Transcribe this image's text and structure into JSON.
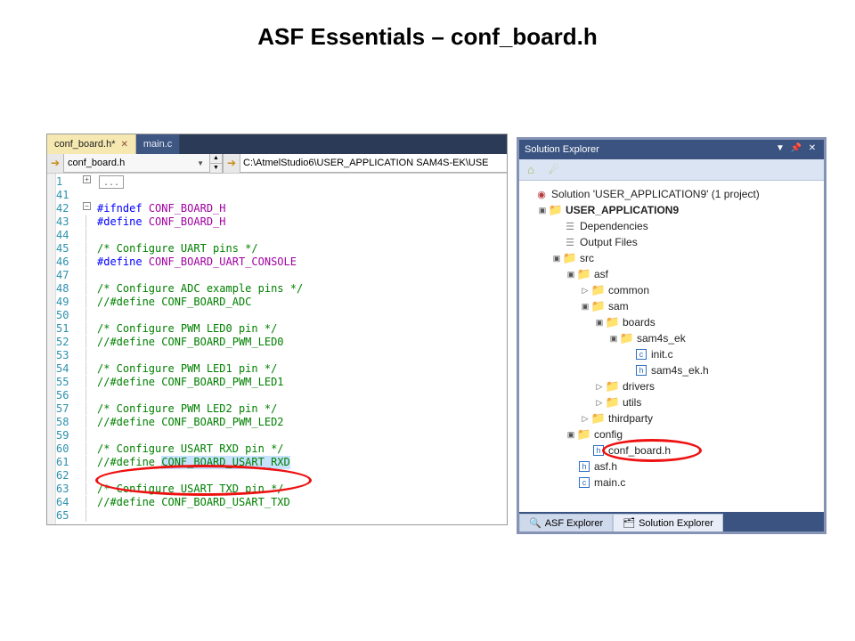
{
  "slide_title": "ASF Essentials – conf_board.h",
  "editor": {
    "tabs": [
      {
        "label": "conf_board.h*",
        "active": true
      },
      {
        "label": "main.c",
        "active": false
      }
    ],
    "nav_scope": "conf_board.h",
    "nav_path": "C:\\AtmelStudio6\\USER_APPLICATION SAM4S-EK\\USE",
    "lines": [
      {
        "n": 1,
        "fold": "plus",
        "segs": [
          {
            "cls": "dots",
            "t": "..."
          }
        ]
      },
      {
        "n": 41,
        "fold": "",
        "segs": []
      },
      {
        "n": 42,
        "fold": "minus",
        "segs": [
          {
            "cls": "c-dir",
            "t": "#ifndef"
          },
          {
            "cls": "c-txt",
            "t": " "
          },
          {
            "cls": "c-def",
            "t": "CONF_BOARD_H"
          }
        ]
      },
      {
        "n": 43,
        "fold": "bar",
        "segs": [
          {
            "cls": "c-dir",
            "t": "#define"
          },
          {
            "cls": "c-txt",
            "t": " "
          },
          {
            "cls": "c-def",
            "t": "CONF_BOARD_H"
          }
        ]
      },
      {
        "n": 44,
        "fold": "bar",
        "segs": []
      },
      {
        "n": 45,
        "fold": "bar",
        "segs": [
          {
            "cls": "c-cmt",
            "t": "/* Configure UART pins */"
          }
        ]
      },
      {
        "n": 46,
        "fold": "bar",
        "segs": [
          {
            "cls": "c-dir",
            "t": "#define"
          },
          {
            "cls": "c-txt",
            "t": " "
          },
          {
            "cls": "c-def",
            "t": "CONF_BOARD_UART_CONSOLE"
          }
        ]
      },
      {
        "n": 47,
        "fold": "bar",
        "segs": []
      },
      {
        "n": 48,
        "fold": "bar",
        "segs": [
          {
            "cls": "c-cmt",
            "t": "/* Configure ADC example pins */"
          }
        ]
      },
      {
        "n": 49,
        "fold": "bar",
        "segs": [
          {
            "cls": "c-cmt",
            "t": "//#define CONF_BOARD_ADC"
          }
        ]
      },
      {
        "n": 50,
        "fold": "bar",
        "segs": []
      },
      {
        "n": 51,
        "fold": "bar",
        "segs": [
          {
            "cls": "c-cmt",
            "t": "/* Configure PWM LED0 pin */"
          }
        ]
      },
      {
        "n": 52,
        "fold": "bar",
        "segs": [
          {
            "cls": "c-cmt",
            "t": "//#define CONF_BOARD_PWM_LED0"
          }
        ]
      },
      {
        "n": 53,
        "fold": "bar",
        "segs": []
      },
      {
        "n": 54,
        "fold": "bar",
        "segs": [
          {
            "cls": "c-cmt",
            "t": "/* Configure PWM LED1 pin */"
          }
        ]
      },
      {
        "n": 55,
        "fold": "bar",
        "segs": [
          {
            "cls": "c-cmt",
            "t": "//#define CONF_BOARD_PWM_LED1"
          }
        ]
      },
      {
        "n": 56,
        "fold": "bar",
        "segs": []
      },
      {
        "n": 57,
        "fold": "bar",
        "segs": [
          {
            "cls": "c-cmt",
            "t": "/* Configure PWM LED2 pin */"
          }
        ]
      },
      {
        "n": 58,
        "fold": "bar",
        "segs": [
          {
            "cls": "c-cmt",
            "t": "//#define CONF_BOARD_PWM_LED2"
          }
        ]
      },
      {
        "n": 59,
        "fold": "bar",
        "segs": []
      },
      {
        "n": 60,
        "fold": "bar",
        "segs": [
          {
            "cls": "c-cmt",
            "t": "/* Configure USART RXD pin */"
          }
        ]
      },
      {
        "n": 61,
        "fold": "bar",
        "segs": [
          {
            "cls": "c-cmt",
            "t": "//#define "
          },
          {
            "cls": "c-cmt c-sel",
            "t": "CONF_BOARD_USART_RXD"
          }
        ]
      },
      {
        "n": 62,
        "fold": "bar",
        "segs": []
      },
      {
        "n": 63,
        "fold": "bar",
        "segs": [
          {
            "cls": "c-cmt",
            "t": "/* Configure USART TXD pin */"
          }
        ]
      },
      {
        "n": 64,
        "fold": "bar",
        "segs": [
          {
            "cls": "c-cmt",
            "t": "//#define CONF_BOARD_USART_TXD"
          }
        ]
      },
      {
        "n": 65,
        "fold": "bar",
        "segs": []
      }
    ]
  },
  "solution": {
    "title": "Solution Explorer",
    "root": "Solution 'USER_APPLICATION9' (1 project)",
    "tree": [
      {
        "ind": 0,
        "exp": "",
        "icon": "sol",
        "glyph": "◉",
        "label_key": "solution.root"
      },
      {
        "ind": 1,
        "exp": "▢",
        "icon": "folder",
        "glyph": "📁",
        "bold": true,
        "t": "USER_APPLICATION9"
      },
      {
        "ind": 2,
        "exp": "",
        "icon": "ref",
        "glyph": "☰",
        "t": "Dependencies"
      },
      {
        "ind": 2,
        "exp": "",
        "icon": "ref",
        "glyph": "☰",
        "t": "Output Files"
      },
      {
        "ind": 2,
        "exp": "▢",
        "icon": "folder",
        "glyph": "📁",
        "t": "src"
      },
      {
        "ind": 3,
        "exp": "▢",
        "icon": "folder",
        "glyph": "📁",
        "t": "asf"
      },
      {
        "ind": 4,
        "exp": "▷",
        "icon": "folder",
        "glyph": "📁",
        "t": "common"
      },
      {
        "ind": 4,
        "exp": "▢",
        "icon": "folder",
        "glyph": "📁",
        "t": "sam"
      },
      {
        "ind": 5,
        "exp": "▢",
        "icon": "folder",
        "glyph": "📁",
        "t": "boards"
      },
      {
        "ind": 6,
        "exp": "▢",
        "icon": "folder",
        "glyph": "📁",
        "t": "sam4s_ek"
      },
      {
        "ind": 7,
        "exp": "",
        "icon": "c",
        "glyph": "c",
        "t": "init.c"
      },
      {
        "ind": 7,
        "exp": "",
        "icon": "h",
        "glyph": "h",
        "t": "sam4s_ek.h"
      },
      {
        "ind": 5,
        "exp": "▷",
        "icon": "folder",
        "glyph": "📁",
        "t": "drivers"
      },
      {
        "ind": 5,
        "exp": "▷",
        "icon": "folder",
        "glyph": "📁",
        "t": "utils"
      },
      {
        "ind": 4,
        "exp": "▷",
        "icon": "folder",
        "glyph": "📁",
        "t": "thirdparty"
      },
      {
        "ind": 3,
        "exp": "▢",
        "icon": "folder",
        "glyph": "📁",
        "t": "config"
      },
      {
        "ind": 4,
        "exp": "",
        "icon": "h",
        "glyph": "h",
        "t": "conf_board.h"
      },
      {
        "ind": 3,
        "exp": "",
        "icon": "h",
        "glyph": "h",
        "t": "asf.h"
      },
      {
        "ind": 3,
        "exp": "",
        "icon": "c",
        "glyph": "c",
        "t": "main.c"
      }
    ],
    "bottom_tabs": [
      {
        "label": "ASF Explorer",
        "icon": "🔍",
        "active": false
      },
      {
        "label": "Solution Explorer",
        "icon": "🗂",
        "active": true
      }
    ]
  }
}
